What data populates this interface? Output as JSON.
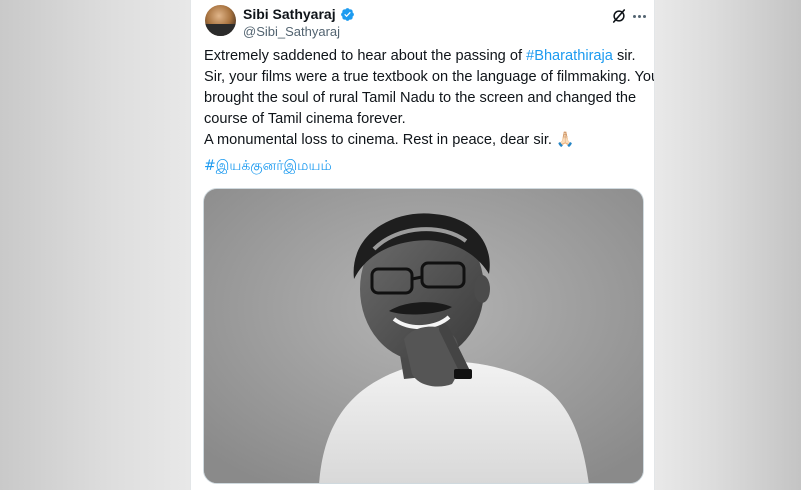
{
  "tweet": {
    "author_name": "Sibi Sathyaraj",
    "author_handle": "@Sibi_Sathyaraj",
    "lines": {
      "l1_pre": "Extremely saddened to hear about the passing of ",
      "l1_tag": "#Bharathiraja",
      "l1_post": " sir.",
      "l2": "Sir, your films were a true textbook on the language of filmmaking. You",
      "l3": "brought the soul of rural Tamil Nadu to the screen and changed the",
      "l4": "course of Tamil cinema forever.",
      "l5": "A monumental loss to cinema. Rest in peace, dear sir. 🙏🏻"
    },
    "tamil_hashtag": "#இயக்குனர்இமயம்"
  },
  "icons": {
    "verified": "verified-badge-icon",
    "grok": "grok-icon",
    "more": "more-options-icon"
  },
  "colors": {
    "link": "#1d9bf0",
    "text": "#0f1419",
    "muted": "#536471"
  }
}
